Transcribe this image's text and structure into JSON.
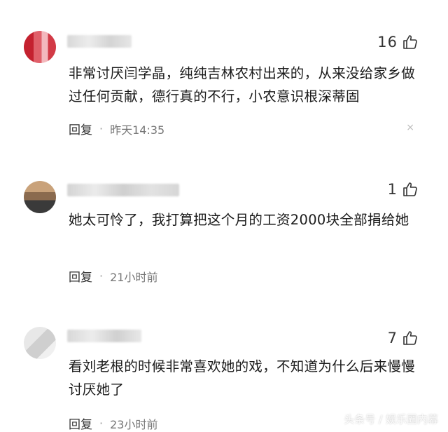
{
  "comments": [
    {
      "likes": "16",
      "text": "非常讨厌闫学晶，纯纯吉林农村出来的，从来没给家乡做过任何贡献，德行真的不行，小农意识根深蒂固",
      "reply_label": "回复",
      "dot": "·",
      "time": "昨天14:35",
      "close": "×"
    },
    {
      "likes": "1",
      "text": "她太可怜了，我打算把这个月的工资2000块全部捐给她",
      "reply_label": "回复",
      "dot": "·",
      "time": "21小时前"
    },
    {
      "likes": "7",
      "text": "看刘老根的时候非常喜欢她的戏，不知道为什么后来慢慢讨厌她了",
      "reply_label": "回复",
      "dot": "·",
      "time": "23小时前"
    }
  ],
  "watermark": "头条号 / 娱乐圈内幕",
  "icons": [
    "thumbs-up-icon",
    "close-icon"
  ]
}
